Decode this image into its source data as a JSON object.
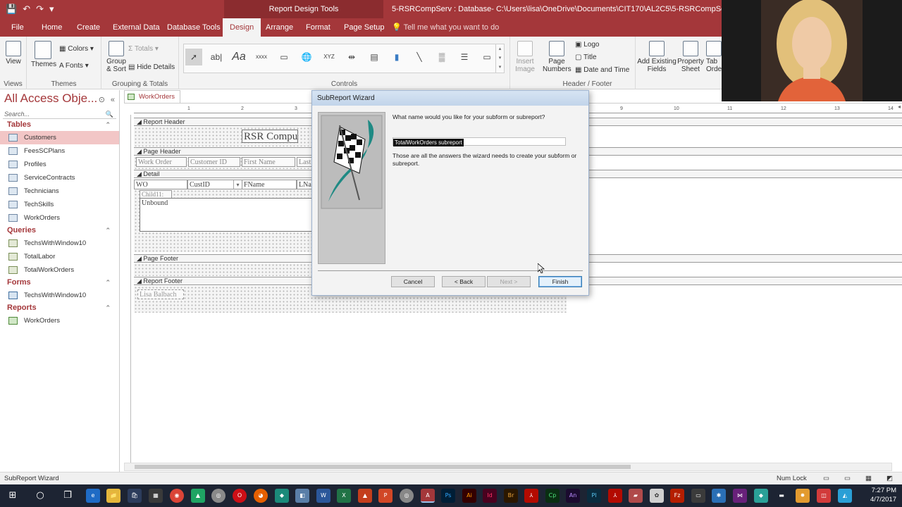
{
  "titlebar": {
    "qat": [
      "💾",
      "↶",
      "↷",
      "▾"
    ],
    "context_tab": "Report Design Tools",
    "window_title": "5-RSRCompServ : Database- C:\\Users\\lisa\\OneDrive\\Documents\\CIT170\\AL2C5\\5-RSRCompServ.accdb (Access"
  },
  "tabs": [
    {
      "label": "File"
    },
    {
      "label": "Home"
    },
    {
      "label": "Create"
    },
    {
      "label": "External Data"
    },
    {
      "label": "Database Tools"
    },
    {
      "label": "Design"
    },
    {
      "label": "Arrange"
    },
    {
      "label": "Format"
    },
    {
      "label": "Page Setup"
    }
  ],
  "tell_me": "Tell me what you want to do",
  "ribbon": {
    "views": {
      "button": "View",
      "group": "Views"
    },
    "themes": {
      "themes": "Themes",
      "colors": "Colors",
      "fonts": "Fonts",
      "group": "Themes"
    },
    "grouping": {
      "group_sort": "Group & Sort",
      "totals": "Totals",
      "hide_details": "Hide Details",
      "group": "Grouping & Totals"
    },
    "controls": {
      "group": "Controls",
      "text_box": "ab|",
      "label": "Aa",
      "button": "xxxx",
      "xyz": "XYZ",
      "insert_image": "Insert Image"
    },
    "header_footer": {
      "page_numbers": "Page Numbers",
      "logo": "Logo",
      "title": "Title",
      "date_time": "Date and Time",
      "group": "Header / Footer"
    },
    "tools": {
      "add_fields": "Add Existing Fields",
      "property_sheet": "Property Sheet",
      "tab_order": "Tab Order"
    }
  },
  "nav": {
    "title": "All Access Obje...",
    "search": "Search...",
    "sections": [
      {
        "name": "Tables",
        "kind": "t",
        "items": [
          "Customers",
          "FeesSCPlans",
          "Profiles",
          "ServiceContracts",
          "Technicians",
          "TechSkills",
          "WorkOrders"
        ]
      },
      {
        "name": "Queries",
        "kind": "q",
        "items": [
          "TechsWithWindow10",
          "TotalLabor",
          "TotalWorkOrders"
        ]
      },
      {
        "name": "Forms",
        "kind": "f",
        "items": [
          "TechsWithWindow10"
        ]
      },
      {
        "name": "Reports",
        "kind": "r",
        "items": [
          "WorkOrders"
        ]
      }
    ],
    "selected": "Customers"
  },
  "document_tab": "WorkOrders",
  "report": {
    "ruler_numbers": [
      "1",
      "2",
      "3",
      "9",
      "10",
      "11",
      "12",
      "13",
      "14"
    ],
    "bands": {
      "report_header": "Report Header",
      "page_header": "Page Header",
      "detail": "Detail",
      "page_footer": "Page Footer",
      "report_footer": "Report Footer"
    },
    "title_text": "RSR Compu",
    "page_header_labels": [
      "Work Order",
      "Customer ID",
      "First Name",
      "Last"
    ],
    "detail_fields": [
      "WO",
      "CustID",
      "FName",
      "LNa"
    ],
    "child_label": "Child11:",
    "unbound": "Unbound",
    "footer_label": "Lisa Balbach"
  },
  "wizard": {
    "title": "SubReport Wizard",
    "question": "What name would you like for your subform or subreport?",
    "name_value": "TotalWorkOrders subreport",
    "info": "Those are all the answers the wizard needs to create your subform or subreport.",
    "buttons": {
      "cancel": "Cancel",
      "back": "< Back",
      "next": "Next >",
      "finish": "Finish"
    }
  },
  "status": {
    "left": "SubReport Wizard",
    "num_lock": "Num Lock"
  },
  "taskbar": {
    "time": "7:27 PM",
    "date": "4/7/2017"
  },
  "colors": {
    "accent": "#a4373a",
    "taskbar": "#1d2433"
  }
}
